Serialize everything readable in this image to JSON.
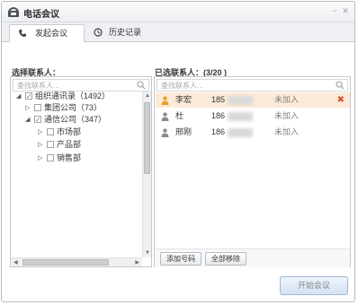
{
  "window": {
    "title": "电话会议",
    "controls": [
      "minimize",
      "close"
    ]
  },
  "tabs": [
    {
      "label": "发起会议",
      "icon": "phone-icon",
      "active": true
    },
    {
      "label": "历史记录",
      "icon": "clock-icon",
      "active": false
    }
  ],
  "left_panel": {
    "label": "选择联系人：",
    "search_placeholder": "查找联系人...",
    "tree": [
      {
        "label": "组织通讯录（1492）",
        "expanded": true,
        "checked": true
      },
      {
        "label": "集团公司（73）",
        "expanded": false,
        "checked": false
      },
      {
        "label": "通信公司（347）",
        "expanded": true,
        "checked": true
      },
      {
        "label": "市场部",
        "expanded": false,
        "checked": false
      },
      {
        "label": "产品部",
        "expanded": false,
        "checked": false
      },
      {
        "label": "销售部",
        "expanded": false,
        "checked": false
      }
    ]
  },
  "right_panel": {
    "label": "已选联系人：(3/20 )",
    "search_placeholder": "查找联系人...",
    "members": [
      {
        "name": "李宏",
        "phone": "185",
        "status": "未加入",
        "selected": true,
        "removable": true
      },
      {
        "name": "杜",
        "phone": "186",
        "status": "未加入",
        "selected": false,
        "removable": false
      },
      {
        "name": "邢刚",
        "phone": "186",
        "status": "未加入",
        "selected": false,
        "removable": false
      }
    ],
    "add_button": "添加号码",
    "remove_all_button": "全部移除"
  },
  "start_button": "开始会议",
  "colors": {
    "selected_row": "#fcead8",
    "delete_red": "#d9502f",
    "person_orange": "#e8a020",
    "person_gray": "#8a8a8a",
    "start_button_bg": "#d3e2f4"
  }
}
